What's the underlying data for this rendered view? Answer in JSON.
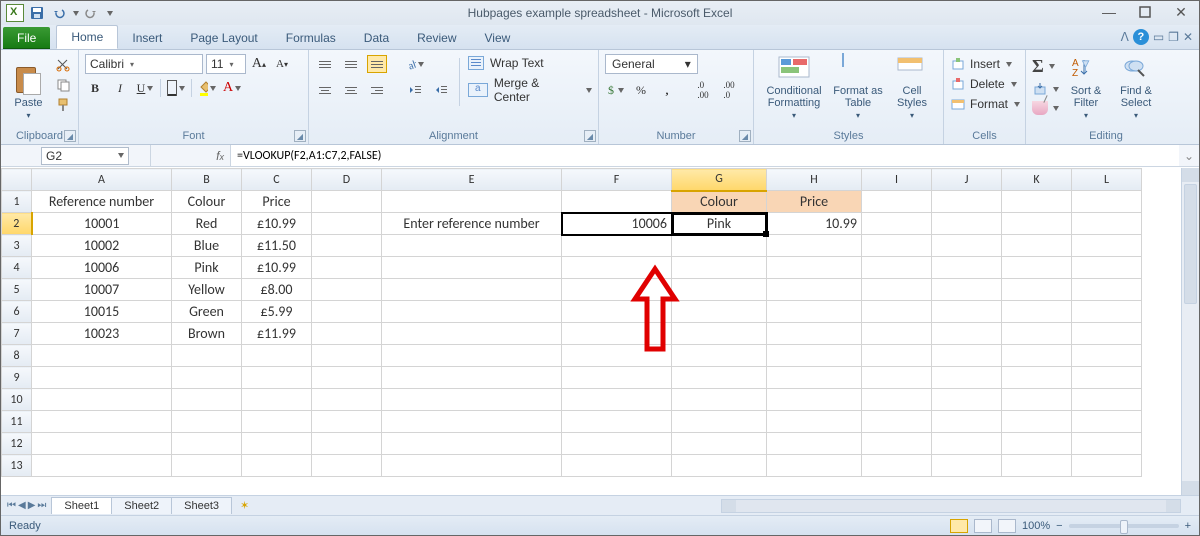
{
  "title": "Hubpages example spreadsheet  -  Microsoft Excel",
  "tabs": {
    "file": "File",
    "home": "Home",
    "insert": "Insert",
    "pageLayout": "Page Layout",
    "formulas": "Formulas",
    "data": "Data",
    "review": "Review",
    "view": "View"
  },
  "ribbon": {
    "clipboard": {
      "label": "Clipboard",
      "paste": "Paste"
    },
    "font": {
      "label": "Font",
      "name": "Calibri",
      "size": "11"
    },
    "alignment": {
      "label": "Alignment",
      "wrap": "Wrap Text",
      "merge": "Merge & Center"
    },
    "number": {
      "label": "Number",
      "format": "General"
    },
    "styles": {
      "label": "Styles",
      "cond": "Conditional Formatting",
      "table": "Format as Table",
      "cell": "Cell Styles"
    },
    "cells": {
      "label": "Cells",
      "insert": "Insert",
      "delete": "Delete",
      "format": "Format"
    },
    "editing": {
      "label": "Editing",
      "sort": "Sort & Filter",
      "find": "Find & Select"
    }
  },
  "namebox": "G2",
  "formula": "=VLOOKUP(F2,A1:C7,2,FALSE)",
  "columns": [
    "A",
    "B",
    "C",
    "D",
    "E",
    "F",
    "G",
    "H",
    "I",
    "J",
    "K",
    "L"
  ],
  "rows": [
    "1",
    "2",
    "3",
    "4",
    "5",
    "6",
    "7",
    "8",
    "9",
    "10",
    "11",
    "12",
    "13"
  ],
  "colWidths": {
    "rh": 30,
    "A": 140,
    "B": 70,
    "C": 70,
    "D": 70,
    "E": 180,
    "F": 110,
    "G": 95,
    "H": 95,
    "I": 70,
    "J": 70,
    "K": 70,
    "L": 70
  },
  "cells": {
    "A1": "Reference number",
    "B1": "Colour",
    "C1": "Price",
    "G1": "Colour",
    "H1": "Price",
    "A2": "10001",
    "B2": "Red",
    "C2": "£10.99",
    "E2": "Enter reference number",
    "F2": "10006",
    "G2": "Pink",
    "H2": "10.99",
    "A3": "10002",
    "B3": "Blue",
    "C3": "£11.50",
    "A4": "10006",
    "B4": "Pink",
    "C4": "£10.99",
    "A5": "10007",
    "B5": "Yellow",
    "C5": "£8.00",
    "A6": "10015",
    "B6": "Green",
    "C6": "£5.99",
    "A7": "10023",
    "B7": "Brown",
    "C7": "£11.99"
  },
  "chart_data": {
    "type": "table",
    "title": "Reference lookup",
    "columns": [
      "Reference number",
      "Colour",
      "Price"
    ],
    "rows": [
      [
        10001,
        "Red",
        10.99
      ],
      [
        10002,
        "Blue",
        11.5
      ],
      [
        10006,
        "Pink",
        10.99
      ],
      [
        10007,
        "Yellow",
        8.0
      ],
      [
        10015,
        "Green",
        5.99
      ],
      [
        10023,
        "Brown",
        11.99
      ]
    ],
    "lookup": {
      "prompt": "Enter reference number",
      "input": 10006,
      "result_colour": "Pink",
      "result_price": 10.99
    }
  },
  "sheets": [
    "Sheet1",
    "Sheet2",
    "Sheet3"
  ],
  "status": {
    "ready": "Ready",
    "zoom": "100%"
  }
}
